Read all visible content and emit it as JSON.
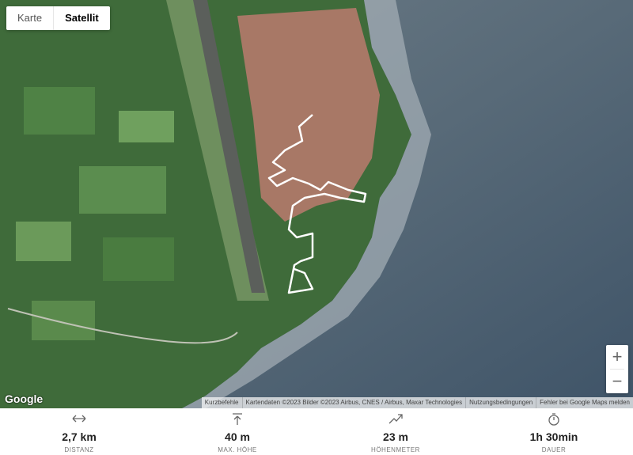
{
  "map_type": {
    "karte_label": "Karte",
    "satellit_label": "Satellit",
    "active": "Satellit"
  },
  "zoom": {
    "in_label": "+",
    "out_label": "−"
  },
  "google_logo": "Google",
  "attribution": {
    "shortcuts": "Kurzbefehle",
    "data": "Kartendaten ©2023 Bilder ©2023 Airbus, CNES / Airbus, Maxar Technologies",
    "terms": "Nutzungsbedingungen",
    "report": "Fehler bei Google Maps melden"
  },
  "stats": [
    {
      "icon": "distance-icon",
      "value": "2,7 km",
      "label": "DISTANZ"
    },
    {
      "icon": "max-height-icon",
      "value": "40 m",
      "label": "MAX. HÖHE"
    },
    {
      "icon": "elevation-gain-icon",
      "value": "23 m",
      "label": "HÖHENMETER"
    },
    {
      "icon": "stopwatch-icon",
      "value": "1h 30min",
      "label": "DAUER"
    }
  ]
}
